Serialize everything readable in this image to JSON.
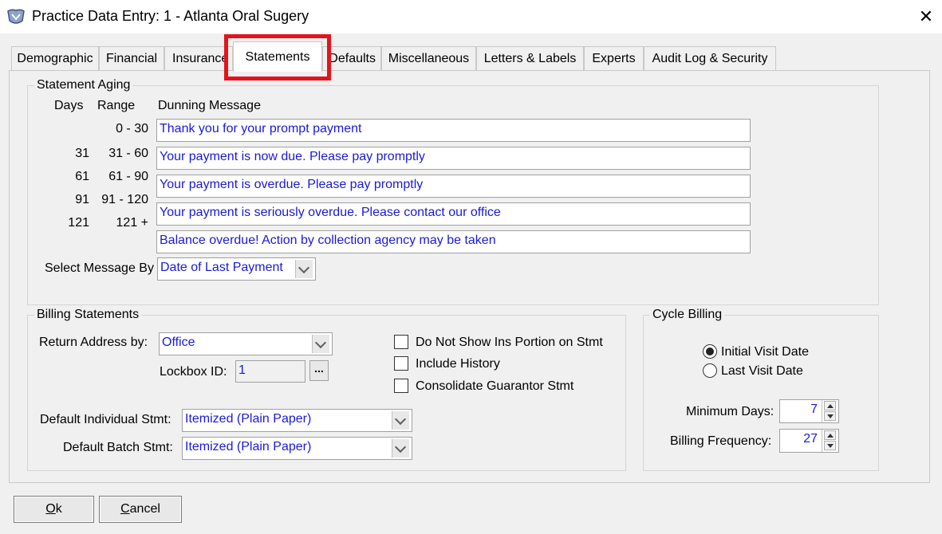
{
  "window": {
    "title": "Practice Data Entry: 1 - Atlanta Oral Sugery",
    "close": "✕"
  },
  "tabs": [
    "Demographic",
    "Financial",
    "Insurance",
    "Statements",
    "Defaults",
    "Miscellaneous",
    "Letters & Labels",
    "Experts",
    "Audit Log & Security"
  ],
  "aging": {
    "legend": "Statement Aging",
    "hdr_days": "Days",
    "hdr_range": "Range",
    "hdr_msg": "Dunning Message",
    "rows": [
      {
        "days": "",
        "range": "0 - 30",
        "message": "Thank you for your prompt payment"
      },
      {
        "days": "31",
        "range": "31 - 60",
        "message": "Your payment is now due.  Please pay promptly"
      },
      {
        "days": "61",
        "range": "61 - 90",
        "message": "Your payment is overdue.  Please pay promptly"
      },
      {
        "days": "91",
        "range": "91 - 120",
        "message": "Your payment is seriously overdue. Please contact our office"
      },
      {
        "days": "121",
        "range": "121 +",
        "message": "Balance overdue! Action by collection agency may be taken"
      }
    ],
    "select_label": "Select Message By",
    "select_value": "Date of Last Payment"
  },
  "billing": {
    "legend": "Billing Statements",
    "return_label": "Return Address by:",
    "return_value": "Office",
    "lockbox_label": "Lockbox ID:",
    "lockbox_value": "1",
    "lockbox_btn": "...",
    "chk_ins": "Do Not Show Ins Portion on Stmt",
    "chk_hist": "Include History",
    "chk_cons": "Consolidate Guarantor Stmt",
    "indiv_label": "Default Individual Stmt:",
    "indiv_value": "Itemized (Plain Paper)",
    "batch_label": "Default Batch Stmt:",
    "batch_value": "Itemized (Plain Paper)"
  },
  "cycle": {
    "legend": "Cycle Billing",
    "radio_initial": "Initial Visit Date",
    "radio_last": "Last Visit Date",
    "min_days_label": "Minimum Days:",
    "min_days_value": "7",
    "freq_label": "Billing Frequency:",
    "freq_value": "27"
  },
  "buttons": {
    "ok_pre": "",
    "ok_u": "O",
    "ok_post": "k",
    "cancel_pre": "",
    "cancel_u": "C",
    "cancel_post": "ancel"
  }
}
